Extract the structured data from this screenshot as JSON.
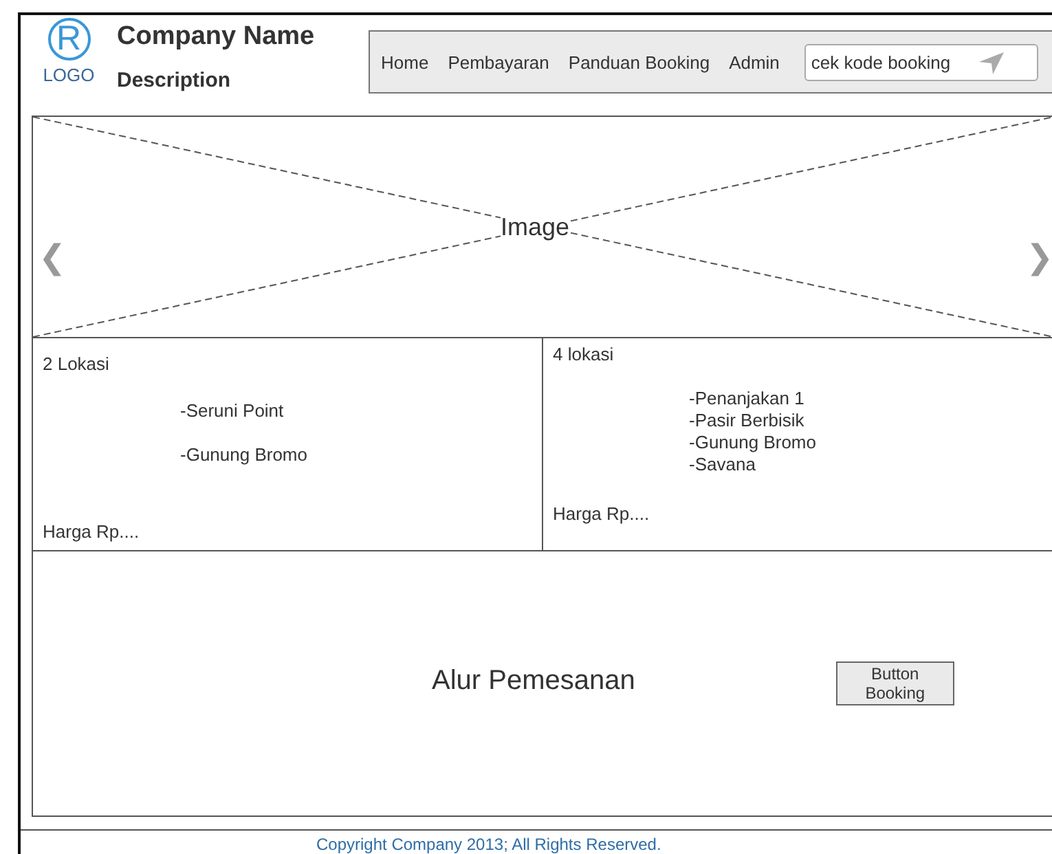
{
  "logo": {
    "mark": "R",
    "caption": "LOGO"
  },
  "company": {
    "name": "Company Name",
    "description": "Description"
  },
  "nav": {
    "items": [
      "Home",
      "Pembayaran",
      "Panduan Booking",
      "Admin"
    ],
    "search": {
      "value": "cek kode booking"
    }
  },
  "carousel": {
    "label": "Image",
    "prev": "❮",
    "next": "❯"
  },
  "packages": [
    {
      "title": "2 Lokasi",
      "places": [
        "-Seruni Point",
        "-Gunung Bromo"
      ],
      "price": "Harga Rp...."
    },
    {
      "title": "4 lokasi",
      "places": [
        "-Penanjakan 1",
        "-Pasir Berbisik",
        "-Gunung Bromo",
        "-Savana"
      ],
      "price": "Harga Rp...."
    }
  ],
  "flow": {
    "title": "Alur Pemesanan",
    "button": "Button Booking"
  },
  "footer": {
    "copyright": "Copyright Company 2013; All Rights Reserved."
  }
}
